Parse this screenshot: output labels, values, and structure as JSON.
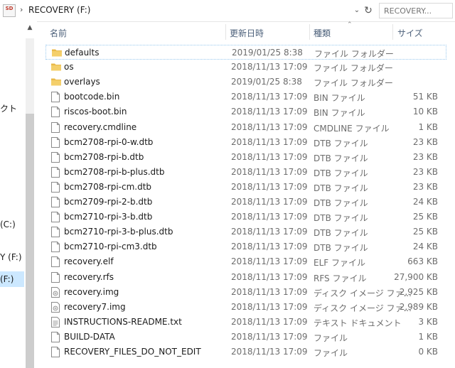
{
  "address": {
    "drive_icon_text": "SD",
    "path": "RECOVERY (F:)",
    "search_placeholder": "RECOVERY..."
  },
  "nav": {
    "items": [
      {
        "label": "クト"
      },
      {
        "label": "(C:)"
      },
      {
        "label": "Y (F:)"
      },
      {
        "label": "(F:)"
      }
    ]
  },
  "columns": {
    "name": "名前",
    "date": "更新日時",
    "type": "種類",
    "size": "サイズ"
  },
  "files": [
    {
      "name": "defaults",
      "date": "2019/01/25 8:38",
      "type": "ファイル フォルダー",
      "size": "",
      "kind": "folder"
    },
    {
      "name": "os",
      "date": "2018/11/13 17:09",
      "type": "ファイル フォルダー",
      "size": "",
      "kind": "folder"
    },
    {
      "name": "overlays",
      "date": "2019/01/25 8:38",
      "type": "ファイル フォルダー",
      "size": "",
      "kind": "folder"
    },
    {
      "name": "bootcode.bin",
      "date": "2018/11/13 17:09",
      "type": "BIN ファイル",
      "size": "51 KB",
      "kind": "file"
    },
    {
      "name": "riscos-boot.bin",
      "date": "2018/11/13 17:09",
      "type": "BIN ファイル",
      "size": "10 KB",
      "kind": "file"
    },
    {
      "name": "recovery.cmdline",
      "date": "2018/11/13 17:09",
      "type": "CMDLINE ファイル",
      "size": "1 KB",
      "kind": "file"
    },
    {
      "name": "bcm2708-rpi-0-w.dtb",
      "date": "2018/11/13 17:09",
      "type": "DTB ファイル",
      "size": "23 KB",
      "kind": "file"
    },
    {
      "name": "bcm2708-rpi-b.dtb",
      "date": "2018/11/13 17:09",
      "type": "DTB ファイル",
      "size": "23 KB",
      "kind": "file"
    },
    {
      "name": "bcm2708-rpi-b-plus.dtb",
      "date": "2018/11/13 17:09",
      "type": "DTB ファイル",
      "size": "23 KB",
      "kind": "file"
    },
    {
      "name": "bcm2708-rpi-cm.dtb",
      "date": "2018/11/13 17:09",
      "type": "DTB ファイル",
      "size": "23 KB",
      "kind": "file"
    },
    {
      "name": "bcm2709-rpi-2-b.dtb",
      "date": "2018/11/13 17:09",
      "type": "DTB ファイル",
      "size": "24 KB",
      "kind": "file"
    },
    {
      "name": "bcm2710-rpi-3-b.dtb",
      "date": "2018/11/13 17:09",
      "type": "DTB ファイル",
      "size": "25 KB",
      "kind": "file"
    },
    {
      "name": "bcm2710-rpi-3-b-plus.dtb",
      "date": "2018/11/13 17:09",
      "type": "DTB ファイル",
      "size": "25 KB",
      "kind": "file"
    },
    {
      "name": "bcm2710-rpi-cm3.dtb",
      "date": "2018/11/13 17:09",
      "type": "DTB ファイル",
      "size": "24 KB",
      "kind": "file"
    },
    {
      "name": "recovery.elf",
      "date": "2018/11/13 17:09",
      "type": "ELF ファイル",
      "size": "663 KB",
      "kind": "file"
    },
    {
      "name": "recovery.rfs",
      "date": "2018/11/13 17:09",
      "type": "RFS ファイル",
      "size": "27,900 KB",
      "kind": "file"
    },
    {
      "name": "recovery.img",
      "date": "2018/11/13 17:09",
      "type": "ディスク イメージ ファ...",
      "size": "2,925 KB",
      "kind": "disk"
    },
    {
      "name": "recovery7.img",
      "date": "2018/11/13 17:09",
      "type": "ディスク イメージ ファ...",
      "size": "2,989 KB",
      "kind": "disk"
    },
    {
      "name": "INSTRUCTIONS-README.txt",
      "date": "2018/11/13 17:09",
      "type": "テキスト ドキュメント",
      "size": "3 KB",
      "kind": "text"
    },
    {
      "name": "BUILD-DATA",
      "date": "2018/11/13 17:09",
      "type": "ファイル",
      "size": "1 KB",
      "kind": "file"
    },
    {
      "name": "RECOVERY_FILES_DO_NOT_EDIT",
      "date": "2018/11/13 17:09",
      "type": "ファイル",
      "size": "0 KB",
      "kind": "file"
    }
  ],
  "colors": {
    "folder": "#e9b949",
    "header_text": "#4c607a",
    "selection": "#cce8ff"
  }
}
